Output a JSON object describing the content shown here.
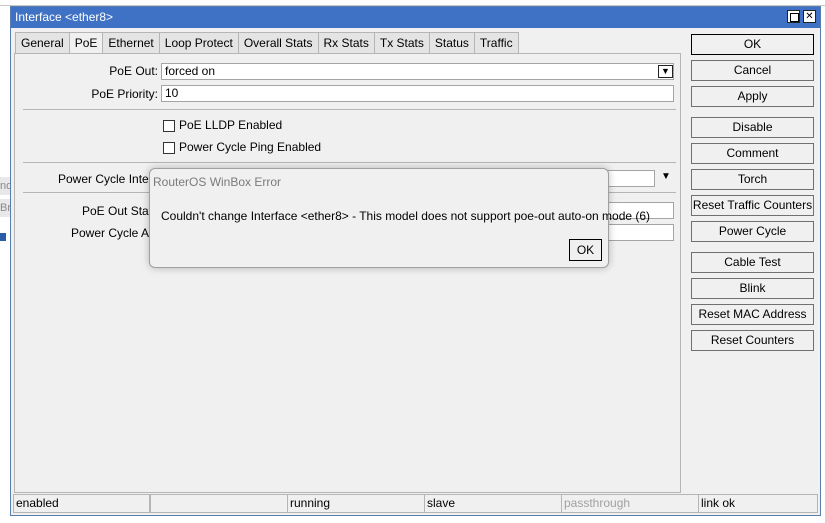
{
  "window": {
    "title": "Interface <ether8>"
  },
  "tabs": [
    "General",
    "PoE",
    "Ethernet",
    "Loop Protect",
    "Overall Stats",
    "Rx Stats",
    "Tx Stats",
    "Status",
    "Traffic"
  ],
  "active_tab": "PoE",
  "form": {
    "poe_out_label": "PoE Out:",
    "poe_out_value": "forced on",
    "poe_priority_label": "PoE Priority:",
    "poe_priority_value": "10",
    "poe_lldp_label": "PoE LLDP Enabled",
    "power_cycle_ping_label": "Power Cycle Ping Enabled",
    "power_cycle_interval_label": "Power Cycle Interva",
    "poe_out_status_label": "PoE Out Statu",
    "power_cycle_after_label": "Power Cycle Afte"
  },
  "buttons": [
    "OK",
    "Cancel",
    "Apply",
    "Disable",
    "Comment",
    "Torch",
    "Reset Traffic Counters",
    "Power Cycle",
    "Cable Test",
    "Blink",
    "Reset MAC Address",
    "Reset Counters"
  ],
  "status_bar": [
    "enabled",
    "",
    "running",
    "slave",
    "passthrough",
    "link ok"
  ],
  "dialog": {
    "title": "RouterOS WinBox Error",
    "message": "Couldn't change Interface <ether8> - This model does not support poe-out auto-on mode (6)",
    "ok_label": "OK"
  },
  "background": {
    "frag1": "nd",
    "frag2": "Bri"
  },
  "icons": {
    "dropdown": "dropdown-arrow-icon",
    "max": "maximize-icon",
    "close": "close-icon"
  }
}
